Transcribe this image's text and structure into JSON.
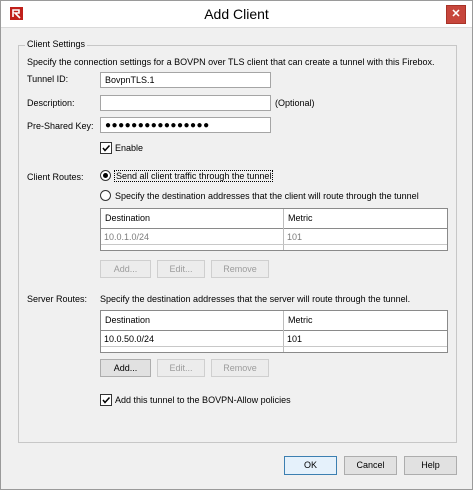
{
  "window": {
    "title": "Add Client",
    "close_glyph": "✕"
  },
  "client_settings": {
    "legend": "Client Settings",
    "description": "Specify the connection settings for a BOVPN over TLS client that can create a tunnel with this Firebox.",
    "tunnel_id": {
      "label": "Tunnel ID:",
      "value": "BovpnTLS.1"
    },
    "description_field": {
      "label": "Description:",
      "value": "",
      "hint": "(Optional)"
    },
    "psk": {
      "label": "Pre-Shared Key:",
      "value": "●●●●●●●●●●●●●●●●"
    },
    "enable": {
      "label": "Enable",
      "checked": true
    }
  },
  "client_routes": {
    "label": "Client Routes:",
    "option_all": {
      "label": "Send all client traffic through the tunnel",
      "selected": true
    },
    "option_specify": {
      "label": "Specify the destination addresses that the client will route through the tunnel",
      "selected": false
    },
    "columns": [
      "Destination",
      "Metric"
    ],
    "rows": [
      {
        "destination": "10.0.1.0/24",
        "metric": "101"
      }
    ],
    "buttons": {
      "add": "Add...",
      "edit": "Edit...",
      "remove": "Remove"
    }
  },
  "server_routes": {
    "label": "Server Routes:",
    "description": "Specify the destination addresses that the server will route through the tunnel.",
    "columns": [
      "Destination",
      "Metric"
    ],
    "rows": [
      {
        "destination": "10.0.50.0/24",
        "metric": "101"
      }
    ],
    "buttons": {
      "add": "Add...",
      "edit": "Edit...",
      "remove": "Remove"
    }
  },
  "policy": {
    "label": "Add this tunnel to the BOVPN-Allow policies",
    "checked": true
  },
  "footer": {
    "ok": "OK",
    "cancel": "Cancel",
    "help": "Help"
  },
  "colors": {
    "close_bg": "#c7463c",
    "app_icon": "#c0201a",
    "default_button_border": "#3c7fb1"
  }
}
